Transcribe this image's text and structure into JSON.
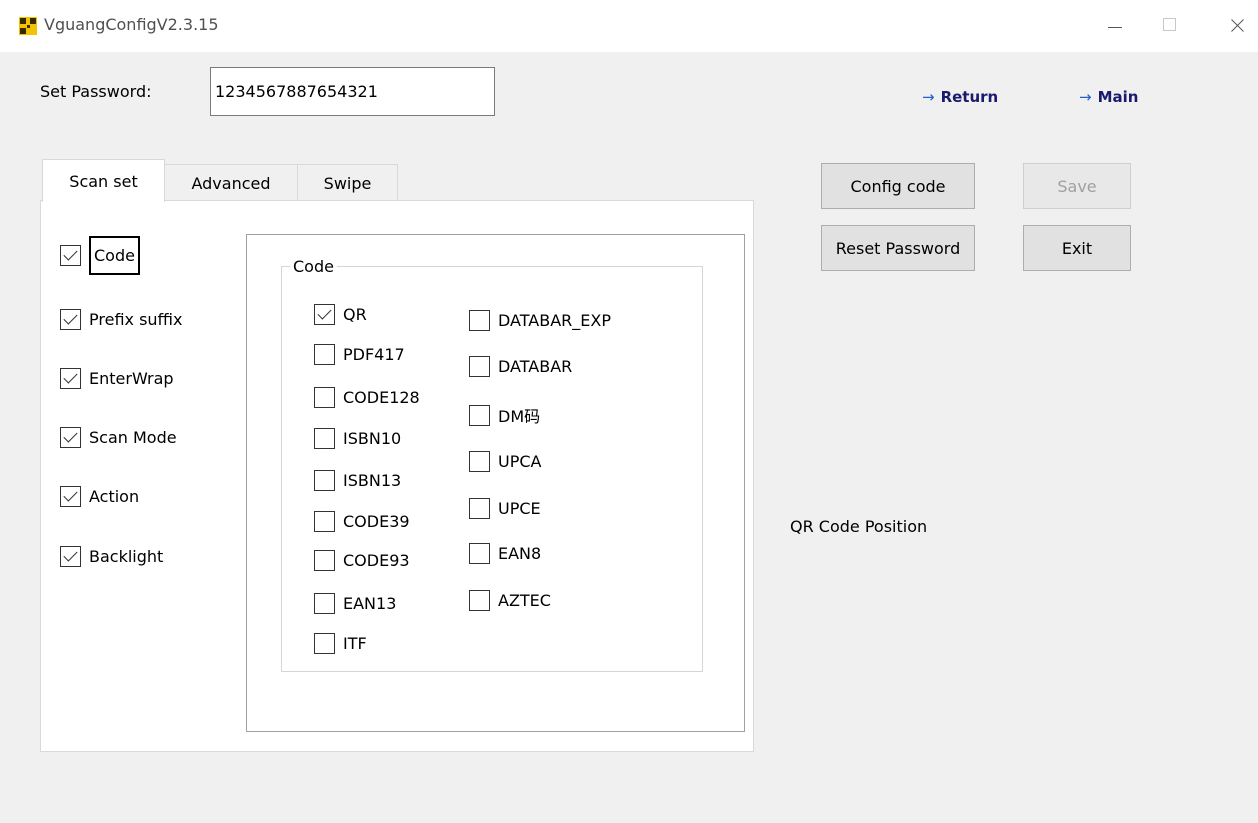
{
  "window": {
    "title": "VguangConfigV2.3.15"
  },
  "password": {
    "label": "Set Password:",
    "value": "1234567887654321"
  },
  "nav": {
    "return_label": "Return",
    "main_label": "Main",
    "arrow": "→"
  },
  "buttons": {
    "config_code": "Config code",
    "save": "Save",
    "reset_password": "Reset Password",
    "exit": "Exit"
  },
  "tabs": [
    {
      "label": "Scan set",
      "active": true
    },
    {
      "label": "Advanced",
      "active": false
    },
    {
      "label": "Swipe",
      "active": false
    }
  ],
  "scan_options": [
    {
      "label": "Code",
      "checked": true
    },
    {
      "label": "Prefix suffix",
      "checked": true
    },
    {
      "label": "EnterWrap",
      "checked": true
    },
    {
      "label": "Scan Mode",
      "checked": true
    },
    {
      "label": "Action",
      "checked": true
    },
    {
      "label": "Backlight",
      "checked": true
    }
  ],
  "code_group": {
    "title": "Code",
    "left_column": [
      {
        "label": "QR",
        "checked": true
      },
      {
        "label": "PDF417",
        "checked": false
      },
      {
        "label": "CODE128",
        "checked": false
      },
      {
        "label": "ISBN10",
        "checked": false
      },
      {
        "label": "ISBN13",
        "checked": false
      },
      {
        "label": "CODE39",
        "checked": false
      },
      {
        "label": "CODE93",
        "checked": false
      },
      {
        "label": "EAN13",
        "checked": false
      },
      {
        "label": "ITF",
        "checked": false
      }
    ],
    "right_column": [
      {
        "label": "DATABAR_EXP",
        "checked": false
      },
      {
        "label": "DATABAR",
        "checked": false
      },
      {
        "label": "DM码",
        "checked": false
      },
      {
        "label": "UPCA",
        "checked": false
      },
      {
        "label": "UPCE",
        "checked": false
      },
      {
        "label": "EAN8",
        "checked": false
      },
      {
        "label": "AZTEC",
        "checked": false
      }
    ]
  },
  "qr_position_label": "QR Code Position",
  "colors": {
    "window_bg": "#f0f0f0",
    "button_bg": "#e1e1e1",
    "link_color": "#1a1a6e",
    "arrow_color": "#2060d0",
    "app_icon": "#f2c300"
  },
  "icons": {
    "app": "app-icon",
    "minimize": "minimize-icon",
    "maximize": "maximize-icon",
    "close": "close-icon",
    "arrow": "arrow-right-icon",
    "check": "checkmark-icon"
  }
}
